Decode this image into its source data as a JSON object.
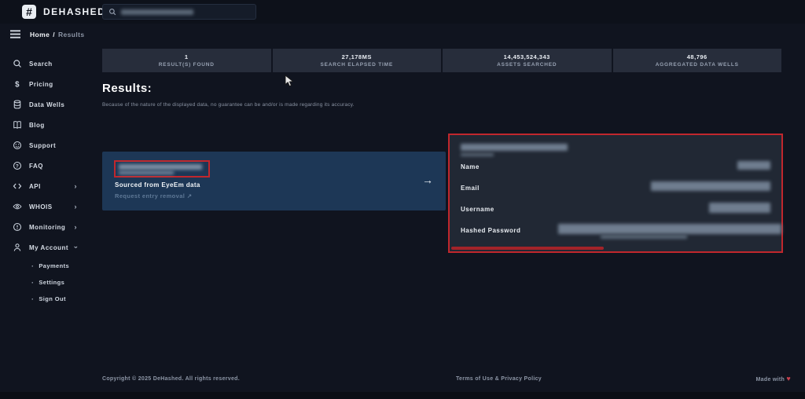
{
  "colors": {
    "accent_red": "#c1272d",
    "card_blue": "#1d3756",
    "panel_bg": "#212834",
    "stats_bg": "#272d3b",
    "page_bg": "#10141f"
  },
  "header": {
    "brand": "DEHASHED",
    "logo_glyph": "#"
  },
  "breadcrumb": {
    "home": "Home",
    "separator": "/",
    "current": "Results"
  },
  "sidebar": {
    "items": [
      {
        "label": "Search"
      },
      {
        "label": "Pricing"
      },
      {
        "label": "Data Wells"
      },
      {
        "label": "Blog"
      },
      {
        "label": "Support"
      },
      {
        "label": "FAQ"
      },
      {
        "label": "API",
        "chevron": "›"
      },
      {
        "label": "WHOIS",
        "chevron": "›"
      },
      {
        "label": "Monitoring",
        "chevron": "›"
      },
      {
        "label": "My Account",
        "chevron": "›"
      }
    ],
    "account_children": [
      {
        "bullet": "·",
        "label": "Payments"
      },
      {
        "bullet": "·",
        "label": "Settings"
      },
      {
        "bullet": "·",
        "label": "Sign Out"
      }
    ]
  },
  "stats": {
    "items": [
      {
        "value": "1",
        "label": "RESULT(S) FOUND"
      },
      {
        "value": "27,178MS",
        "label": "SEARCH ELAPSED TIME"
      },
      {
        "value": "14,453,524,343",
        "label": "ASSETS SEARCHED"
      },
      {
        "value": "48,796",
        "label": "AGGREGATED DATA WELLS"
      }
    ]
  },
  "results": {
    "heading": "Results:",
    "disclaimer": "Because of the nature of the displayed data, no guarantee can be and/or is made regarding its accuracy.",
    "card": {
      "source": "Sourced from EyeEm data",
      "removal_link": "Request entry removal",
      "removal_icon": "↗",
      "arrow_icon": "→"
    }
  },
  "detail": {
    "fields": [
      {
        "label": "Name"
      },
      {
        "label": "Email"
      },
      {
        "label": "Username"
      },
      {
        "label": "Hashed Password"
      }
    ]
  },
  "footer": {
    "copyright": "Copyright © 2025 DeHashed. All rights reserved.",
    "legal": "Terms of Use & Privacy Policy",
    "made_with": "Made with",
    "heart": "♥"
  }
}
